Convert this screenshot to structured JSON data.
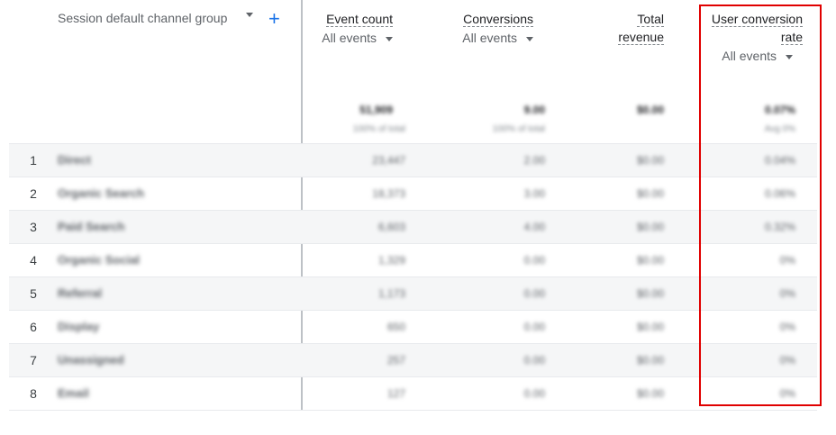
{
  "header": {
    "dimension_label": "Session default channel group",
    "dimension_dropdown_icon": "caret-down-icon",
    "add_dimension_icon": "plus-icon",
    "add_dimension_symbol": "+"
  },
  "metrics": [
    {
      "title_line1": "Event count",
      "title_line2": "",
      "filter": "All events",
      "total": "51,909",
      "total_sub": "100% of total"
    },
    {
      "title_line1": "Conversions",
      "title_line2": "",
      "filter": "All events",
      "total": "9.00",
      "total_sub": "100% of total"
    },
    {
      "title_line1": "Total",
      "title_line2": "revenue",
      "filter": "",
      "total": "$0.00",
      "total_sub": ""
    },
    {
      "title_line1": "User conversion",
      "title_line2": "rate",
      "filter": "All events",
      "total": "0.07%",
      "total_sub": "Avg 0%"
    }
  ],
  "rows": [
    {
      "num": "1",
      "channel": "Direct",
      "event_count": "23,447",
      "conversions": "2.00",
      "revenue": "$0.00",
      "conv_rate": "0.04%"
    },
    {
      "num": "2",
      "channel": "Organic Search",
      "event_count": "18,373",
      "conversions": "3.00",
      "revenue": "$0.00",
      "conv_rate": "0.06%"
    },
    {
      "num": "3",
      "channel": "Paid Search",
      "event_count": "6,603",
      "conversions": "4.00",
      "revenue": "$0.00",
      "conv_rate": "0.32%"
    },
    {
      "num": "4",
      "channel": "Organic Social",
      "event_count": "1,329",
      "conversions": "0.00",
      "revenue": "$0.00",
      "conv_rate": "0%"
    },
    {
      "num": "5",
      "channel": "Referral",
      "event_count": "1,173",
      "conversions": "0.00",
      "revenue": "$0.00",
      "conv_rate": "0%"
    },
    {
      "num": "6",
      "channel": "Display",
      "event_count": "650",
      "conversions": "0.00",
      "revenue": "$0.00",
      "conv_rate": "0%"
    },
    {
      "num": "7",
      "channel": "Unassigned",
      "event_count": "257",
      "conversions": "0.00",
      "revenue": "$0.00",
      "conv_rate": "0%"
    },
    {
      "num": "8",
      "channel": "Email",
      "event_count": "127",
      "conversions": "0.00",
      "revenue": "$0.00",
      "conv_rate": "0%"
    }
  ],
  "colors": {
    "accent": "#1a73e8",
    "highlight": "#e00000"
  }
}
